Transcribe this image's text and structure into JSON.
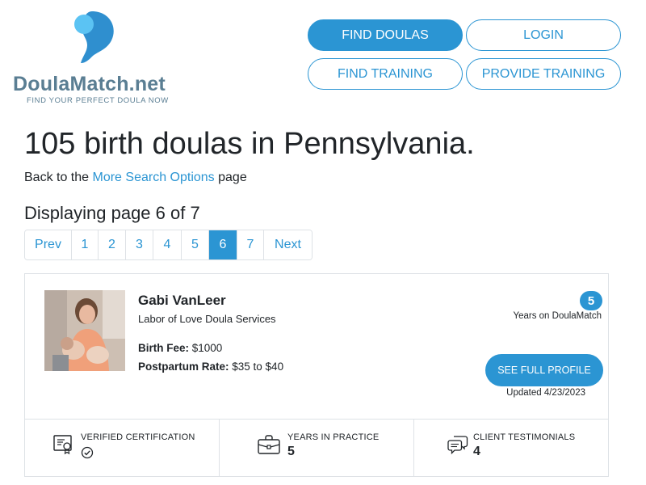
{
  "logo": {
    "name": "DoulaMatch.net",
    "tagline": "FIND YOUR PERFECT DOULA NOW"
  },
  "nav": {
    "find_doulas": "FIND DOULAS",
    "login": "LOGIN",
    "find_training": "FIND TRAINING",
    "provide_training": "PROVIDE TRAINING"
  },
  "heading": "105 birth doulas in Pennsylvania.",
  "back": {
    "prefix": "Back to the ",
    "link": "More Search Options",
    "suffix": " page"
  },
  "display": "Displaying page 6 of 7",
  "pagination": {
    "prev": "Prev",
    "pages": [
      "1",
      "2",
      "3",
      "4",
      "5",
      "6",
      "7"
    ],
    "next": "Next",
    "active": "6"
  },
  "doula": {
    "name": "Gabi VanLeer",
    "business": "Labor of Love Doula Services",
    "birth_fee_label": "Birth Fee:",
    "birth_fee": " $1000",
    "postpartum_label": "Postpartum Rate:",
    "postpartum": " $35 to $40",
    "years_on_site": "5",
    "years_on_site_label": "Years on DoulaMatch",
    "profile_button": "SEE FULL PROFILE",
    "updated": "Updated 4/23/2023",
    "stats": {
      "certification_label": "VERIFIED CERTIFICATION",
      "practice_label": "YEARS IN PRACTICE",
      "practice_value": "5",
      "testimonials_label": "CLIENT TESTIMONIALS",
      "testimonials_value": "4"
    }
  },
  "icons": {
    "certificate": "certificate-icon",
    "check": "check-circle-icon",
    "briefcase": "briefcase-icon",
    "chat": "chat-bubbles-icon"
  },
  "colors": {
    "accent": "#2b95d3",
    "logo_text": "#5a7e93",
    "border": "#dee2e6",
    "text": "#212529"
  }
}
